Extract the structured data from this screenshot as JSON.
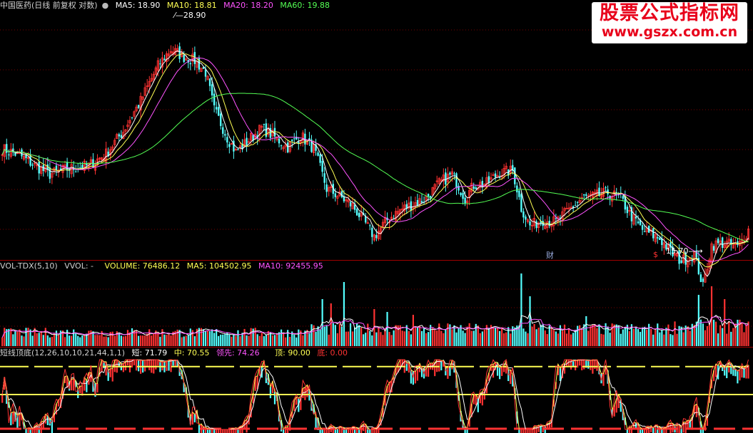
{
  "header": {
    "title": "中国医药(日线 前复权 对数)",
    "ma5": "MA5: 18.90",
    "ma10": "MA10: 18.81",
    "ma20": "MA20: 18.20",
    "ma60": "MA60: 19.88"
  },
  "volume_header": {
    "name": "VOL-TDX(5,10)",
    "vvol": "VVOL: -",
    "volume": "VOLUME: 76486.12",
    "ma5": "MA5: 104502.95",
    "ma10": "MA10: 92455.95"
  },
  "osc_header": {
    "name": "短线顶底(12,26,10,10,21,44,1,1)",
    "short": "短: 71.79",
    "mid": "中: 70.55",
    "lead": "领先: 74.26",
    "top": "顶: 90.00",
    "bottom": "底: 0.00"
  },
  "annotations": {
    "high": "28.90",
    "low": "15.70",
    "cai": "财",
    "dollar": "$"
  },
  "watermark": {
    "title": "股票公式指标网",
    "url": "www.gszx.com.cn"
  },
  "colors": {
    "up": "#ff3232",
    "down": "#54ffff",
    "ma5": "#ffffff",
    "ma10": "#ffff54",
    "ma20": "#ff54ff",
    "ma60": "#54ff54",
    "grid": "#7a0000",
    "oscTop": "#ffff54",
    "oscMid": "#ffff54",
    "oscBot": "#ff3232"
  },
  "chart_data": [
    {
      "type": "candlestick",
      "price_scale": "log",
      "ylim": [
        15.0,
        31.0
      ],
      "anchors": [
        [
          0,
          20.6
        ],
        [
          8,
          20.2
        ],
        [
          15,
          19.6
        ],
        [
          22,
          19.1
        ],
        [
          30,
          19.4
        ],
        [
          40,
          19.6
        ],
        [
          48,
          20.3
        ],
        [
          56,
          21.7
        ],
        [
          64,
          23.7
        ],
        [
          72,
          26.3
        ],
        [
          78,
          27.6
        ],
        [
          84,
          27.0
        ],
        [
          89,
          26.7
        ],
        [
          94,
          25.8
        ],
        [
          98,
          23.1
        ],
        [
          104,
          21.3
        ],
        [
          108,
          20.4
        ],
        [
          113,
          21.0
        ],
        [
          120,
          21.9
        ],
        [
          126,
          21.3
        ],
        [
          132,
          20.7
        ],
        [
          138,
          21.4
        ],
        [
          144,
          20.6
        ],
        [
          150,
          18.3
        ],
        [
          156,
          17.9
        ],
        [
          162,
          17.4
        ],
        [
          168,
          16.5
        ],
        [
          172,
          15.9
        ],
        [
          178,
          16.7
        ],
        [
          184,
          17.2
        ],
        [
          190,
          17.5
        ],
        [
          196,
          17.8
        ],
        [
          202,
          18.6
        ],
        [
          208,
          19.1
        ],
        [
          214,
          17.8
        ],
        [
          218,
          18.5
        ],
        [
          224,
          18.6
        ],
        [
          230,
          19.2
        ],
        [
          236,
          19.3
        ],
        [
          240,
          17.3
        ],
        [
          244,
          16.4
        ],
        [
          250,
          16.7
        ],
        [
          256,
          16.6
        ],
        [
          262,
          17.2
        ],
        [
          268,
          17.8
        ],
        [
          274,
          17.9
        ],
        [
          280,
          18.1
        ],
        [
          286,
          17.8
        ],
        [
          290,
          17.0
        ],
        [
          296,
          16.2
        ],
        [
          304,
          15.8
        ],
        [
          310,
          15.1
        ],
        [
          314,
          14.8
        ],
        [
          320,
          15.1
        ],
        [
          324,
          13.7
        ],
        [
          328,
          15.5
        ],
        [
          334,
          15.6
        ],
        [
          340,
          15.4
        ],
        [
          345,
          16.2
        ]
      ],
      "high_label": {
        "value": "28.90",
        "index": 82
      },
      "low_label": {
        "value": "15.70",
        "index": 326
      },
      "moving_averages": [
        {
          "name": "MA5",
          "period": 5,
          "color": "#ffffff"
        },
        {
          "name": "MA10",
          "period": 10,
          "color": "#ffff54"
        },
        {
          "name": "MA20",
          "period": 20,
          "color": "#ff54ff"
        },
        {
          "name": "MA60",
          "period": 60,
          "color": "#54ff54"
        }
      ],
      "last_values": {
        "MA5": 18.9,
        "MA10": 18.81,
        "MA20": 18.2,
        "MA60": 19.88
      }
    },
    {
      "type": "bar",
      "name": "VOL-TDX(5,10)",
      "last_values": {
        "VOLUME": 76486.12,
        "MA5": 104502.95,
        "MA10": 92455.95
      },
      "spikes": [
        [
          148,
          3.3
        ],
        [
          152,
          3.0
        ],
        [
          158,
          4.5
        ],
        [
          172,
          2.6
        ],
        [
          178,
          2.4
        ],
        [
          190,
          2.2
        ],
        [
          240,
          5.1
        ],
        [
          244,
          3.5
        ],
        [
          270,
          2.1
        ],
        [
          322,
          3.6
        ],
        [
          328,
          4.2
        ],
        [
          334,
          3.3
        ]
      ]
    },
    {
      "type": "line",
      "name": "短线顶底(12,26,10,10,21,44,1,1)",
      "ylim": [
        0,
        100
      ],
      "levels": {
        "top": 90,
        "mid": 50,
        "bottom": 0
      },
      "last_values": {
        "短": 71.79,
        "中": 70.55,
        "领先": 74.26,
        "顶": 90.0,
        "底": 0.0
      }
    }
  ]
}
